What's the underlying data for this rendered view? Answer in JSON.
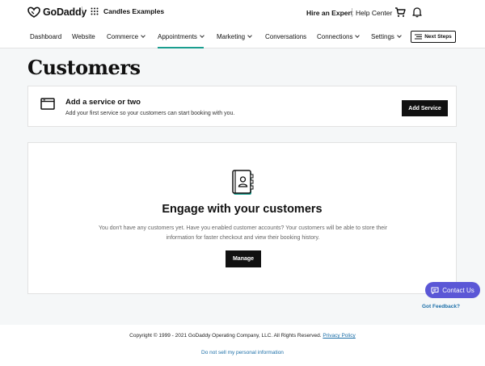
{
  "brand": {
    "name": "GoDaddy",
    "icon": "godaddy-logo-icon"
  },
  "site": {
    "name": "Candles Examples",
    "icon": "apps-grid-icon"
  },
  "header": {
    "hire_expert": "Hire an Expert",
    "help_center": "Help Center",
    "cart_icon": "cart-icon",
    "bell_icon": "bell-icon"
  },
  "nav": {
    "items": [
      {
        "label": "Dashboard"
      },
      {
        "label": "Website"
      },
      {
        "label": "Commerce"
      },
      {
        "label": "Appointments"
      },
      {
        "label": "Marketing"
      },
      {
        "label": "Conversations"
      },
      {
        "label": "Connections"
      },
      {
        "label": "Settings"
      }
    ],
    "active": "Appointments",
    "next_steps": "Next Steps"
  },
  "page": {
    "title": "Customers"
  },
  "service_card": {
    "title": "Add a service or two",
    "subtitle": "Add your first service so your customers can start booking with you.",
    "button": "Add Service"
  },
  "empty_state": {
    "title": "Engage with your customers",
    "description": "You don't have any customers yet. Have you enabled customer accounts? Your customers will be able to store their information for faster checkout and view their booking history.",
    "button": "Manage"
  },
  "support": {
    "contact": "Contact Us",
    "feedback": "Got Feedback?"
  },
  "footer": {
    "copyright": "Copyright © 1999 - 2021 GoDaddy Operating Company, LLC. All Rights Reserved.",
    "privacy": "Privacy Policy",
    "do_not_sell": "Do not sell my personal information"
  },
  "colors": {
    "accent": "#1a9e8f",
    "primary_button": "#111111",
    "contact_button": "#5b57d6",
    "link": "#1c6fa8",
    "background": "#f5f7f8"
  }
}
